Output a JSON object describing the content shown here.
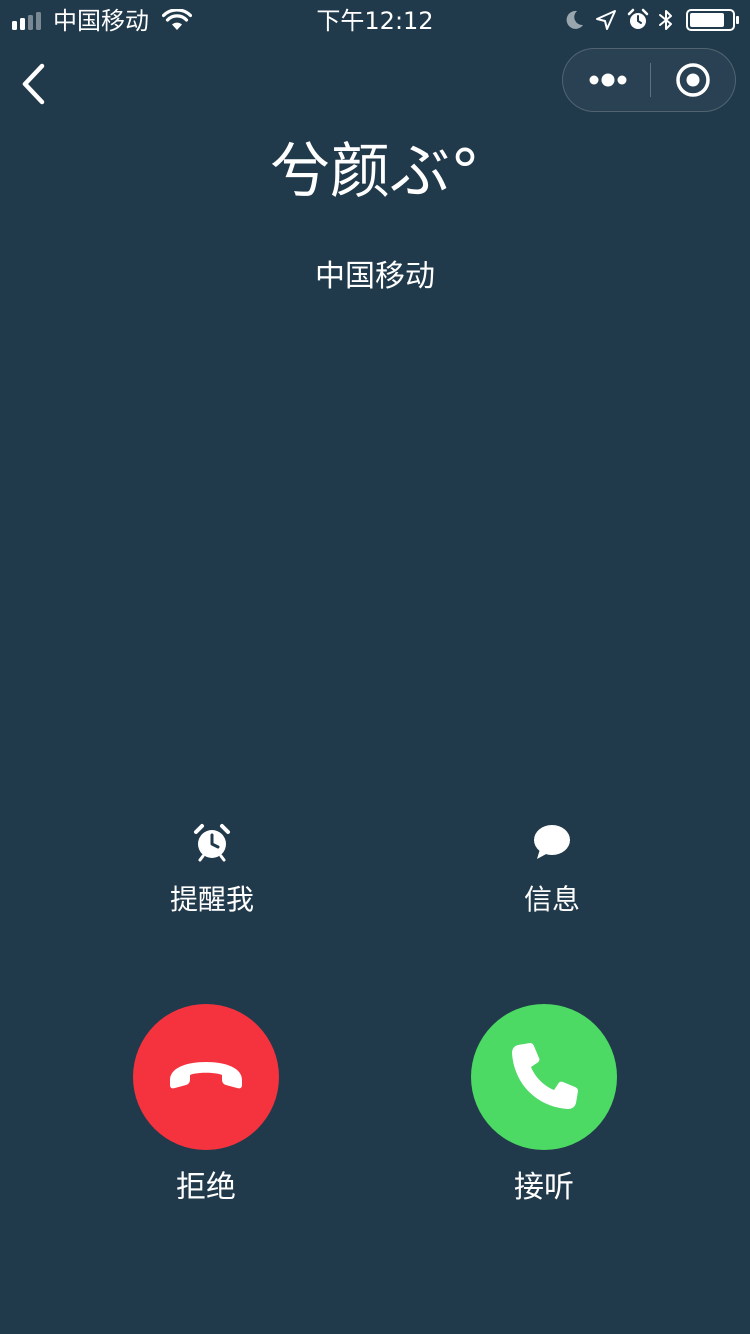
{
  "status_bar": {
    "carrier": "中国移动",
    "time": "下午12:12",
    "signal_icon": "signal-bars-icon",
    "wifi_icon": "wifi-icon",
    "status_icons": [
      "moon-icon",
      "location-arrow-icon",
      "alarm-icon",
      "bluetooth-icon",
      "battery-icon"
    ]
  },
  "nav": {
    "back_icon": "chevron-left-icon",
    "more_icon": "more-dots-icon",
    "close_icon": "target-circle-icon"
  },
  "caller": {
    "name": "兮颜ぶ°",
    "subtitle": "中国移动"
  },
  "actions": {
    "remind": {
      "label": "提醒我",
      "icon": "alarm-clock-icon"
    },
    "message": {
      "label": "信息",
      "icon": "speech-bubble-icon"
    }
  },
  "call_buttons": {
    "decline": {
      "label": "拒绝",
      "icon": "hang-up-phone-icon",
      "color": "#F5333F"
    },
    "accept": {
      "label": "接听",
      "icon": "phone-icon",
      "color": "#4CD964"
    }
  },
  "colors": {
    "background": "#213A4B",
    "text": "#FFFFFF"
  }
}
